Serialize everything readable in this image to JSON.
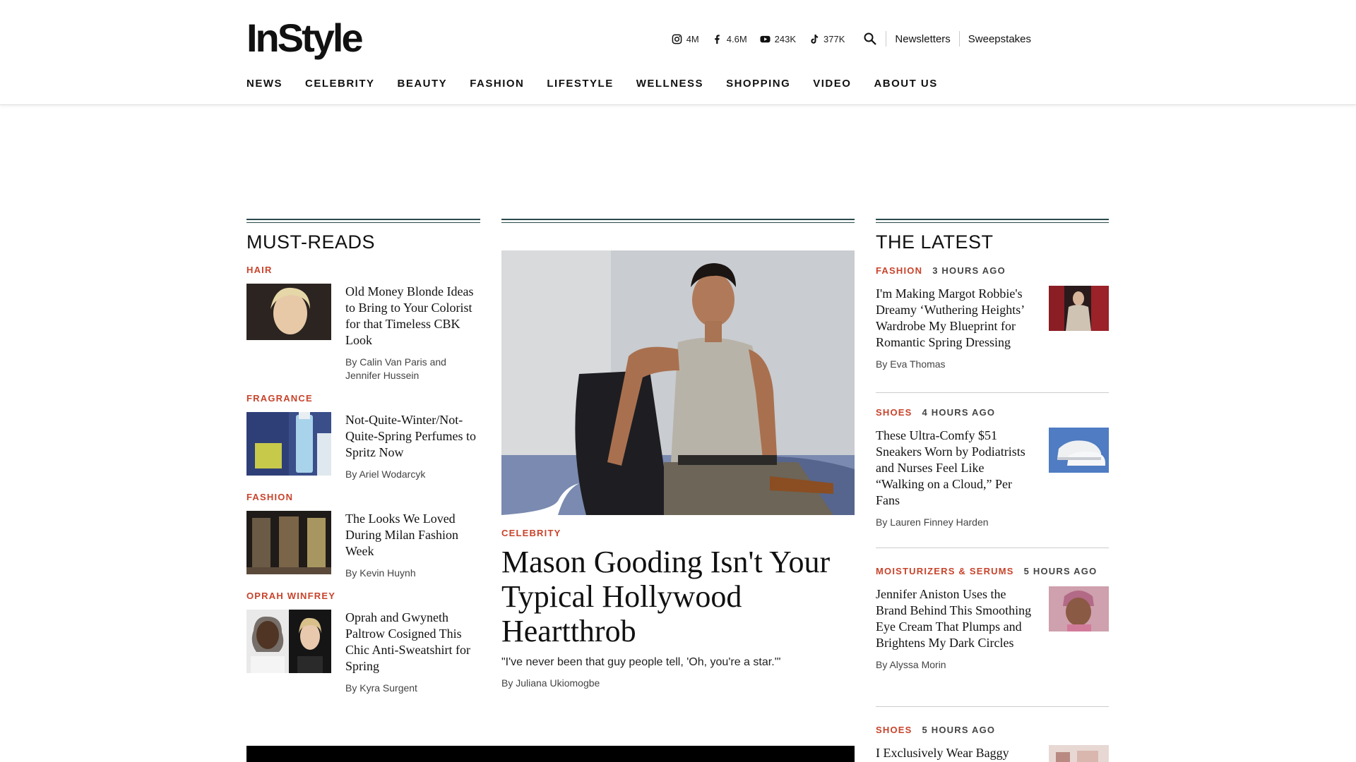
{
  "header": {
    "logo": "InStyle",
    "social": [
      {
        "icon": "instagram-icon",
        "count": "4M"
      },
      {
        "icon": "facebook-icon",
        "count": "4.6M"
      },
      {
        "icon": "youtube-icon",
        "count": "243K"
      },
      {
        "icon": "tiktok-icon",
        "count": "377K"
      }
    ],
    "links": [
      "Newsletters",
      "Sweepstakes"
    ],
    "nav": [
      "NEWS",
      "CELEBRITY",
      "BEAUTY",
      "FASHION",
      "LIFESTYLE",
      "WELLNESS",
      "SHOPPING",
      "VIDEO",
      "ABOUT US"
    ]
  },
  "must_reads": {
    "title": "MUST-READS",
    "items": [
      {
        "kicker": "HAIR",
        "headline": "Old Money Blonde Ideas to Bring to Your Colorist for that Timeless CBK Look",
        "byline": "By Calin Van Paris and Jennifer Hussein"
      },
      {
        "kicker": "FRAGRANCE",
        "headline": "Not-Quite-Winter/Not-Quite-Spring Perfumes to Spritz Now",
        "byline": "By Ariel Wodarcyk"
      },
      {
        "kicker": "FASHION",
        "headline": "The Looks We Loved During Milan Fashion Week",
        "byline": "By Kevin Huynh"
      },
      {
        "kicker": "OPRAH WINFREY",
        "headline": "Oprah and Gwyneth Paltrow Cosigned This Chic Anti-Sweatshirt for Spring",
        "byline": "By Kyra Surgent"
      }
    ]
  },
  "hero": {
    "kicker": "CELEBRITY",
    "title": "Mason Gooding Isn't Your Typical Hollywood Heartthrob",
    "dek": "\"I've never been that guy people tell, 'Oh, you're a star.'\"",
    "byline": "By Juliana Ukiomogbe"
  },
  "latest": {
    "title": "THE LATEST",
    "items": [
      {
        "kicker": "FASHION",
        "time": "3 HOURS AGO",
        "headline": "I'm Making Margot Robbie's Dreamy ‘Wuthering Heights’ Wardrobe My Blueprint for Romantic Spring Dressing",
        "byline": "By Eva Thomas"
      },
      {
        "kicker": "SHOES",
        "time": "4 HOURS AGO",
        "headline": "These Ultra-Comfy $51 Sneakers Worn by Podiatrists and Nurses Feel Like “Walking on a Cloud,” Per Fans",
        "byline": "By Lauren Finney Harden"
      },
      {
        "kicker": "MOISTURIZERS & SERUMS",
        "time": "5 HOURS AGO",
        "headline": "Jennifer Aniston Uses the Brand Behind This Smoothing Eye Cream That Plumps and Brightens My Dark Circles",
        "byline": "By Alyssa Morin"
      },
      {
        "kicker": "SHOES",
        "time": "5 HOURS AGO",
        "headline": "I Exclusively Wear Baggy",
        "byline": ""
      }
    ]
  }
}
